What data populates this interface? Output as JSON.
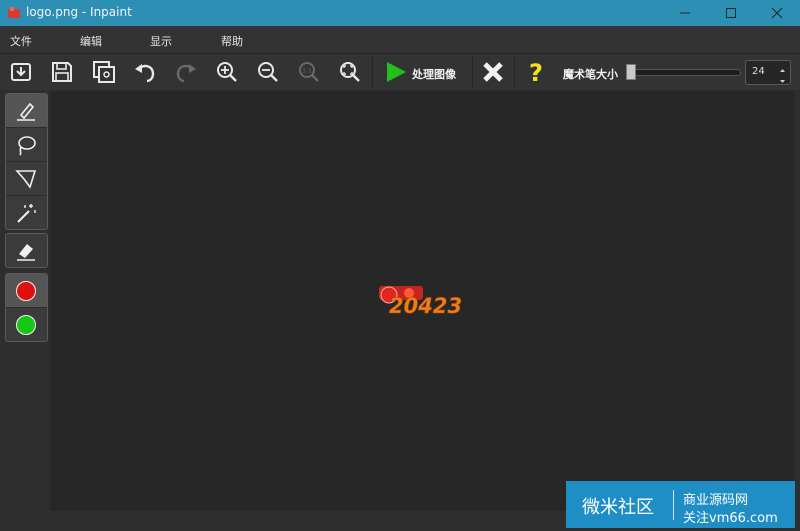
{
  "window": {
    "title": "logo.png - Inpaint"
  },
  "menu": [
    "文件",
    "编辑",
    "显示",
    "帮助"
  ],
  "toolbar": {
    "buttons": [
      {
        "icon": "open-icon"
      },
      {
        "icon": "save-icon"
      },
      {
        "icon": "save-as-icon"
      },
      {
        "icon": "undo-icon"
      },
      {
        "icon": "redo-icon"
      },
      {
        "icon": "zoom-in-icon"
      },
      {
        "icon": "zoom-out-icon"
      },
      {
        "icon": "zoom-actual-icon"
      },
      {
        "icon": "fit-icon"
      }
    ],
    "zoom_actual_glyph": "1:1",
    "process_label": "处理图像",
    "brush_label": "魔术笔大小",
    "brush_size": "24",
    "brush_size_fraction": 0.0
  },
  "tools": [
    {
      "icon": "marker-icon",
      "active": true
    },
    {
      "icon": "lasso-icon"
    },
    {
      "icon": "polygon-lasso-icon"
    },
    {
      "icon": "magic-wand-icon"
    },
    {
      "icon": "eraser-icon"
    },
    {
      "icon": "red-marker-icon"
    },
    {
      "icon": "green-marker-icon"
    }
  ],
  "colors": {
    "accent": "#2d8fb4",
    "play": "#22c01a",
    "help": "#f5e01b",
    "red": "#e11010",
    "green": "#16c816"
  },
  "canvas_logo_text": "20423",
  "watermark": {
    "main": "微米社区",
    "sub1": "商业源码网",
    "sub2": "关注vm66.com"
  }
}
